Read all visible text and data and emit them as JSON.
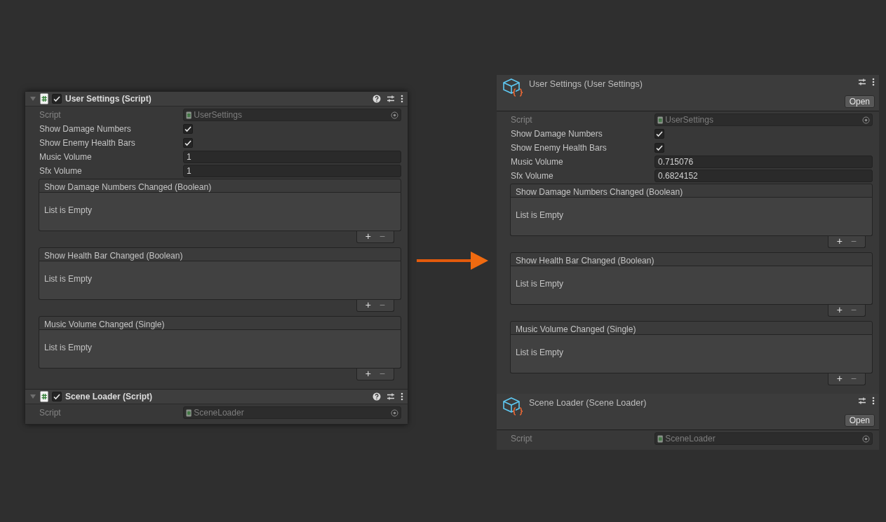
{
  "left_inspector": {
    "components": [
      {
        "kind": "script",
        "title": "User Settings (Script)",
        "expanded": true,
        "enabled": true,
        "fields": [
          {
            "kind": "object",
            "label": "Script",
            "value": "UserSettings",
            "disabled": true
          },
          {
            "kind": "toggle",
            "label": "Show Damage Numbers",
            "checked": true
          },
          {
            "kind": "toggle",
            "label": "Show Enemy Health Bars",
            "checked": true
          },
          {
            "kind": "number",
            "label": "Music Volume",
            "value": "1"
          },
          {
            "kind": "number",
            "label": "Sfx Volume",
            "value": "1"
          }
        ],
        "events": [
          {
            "title": "Show Damage Numbers Changed (Boolean)",
            "empty_text": "List is Empty",
            "add": "+",
            "remove": "−"
          },
          {
            "title": "Show Health Bar Changed (Boolean)",
            "empty_text": "List is Empty",
            "add": "+",
            "remove": "−"
          },
          {
            "title": "Music Volume Changed (Single)",
            "empty_text": "List is Empty",
            "add": "+",
            "remove": "−"
          }
        ]
      },
      {
        "kind": "script",
        "title": "Scene Loader (Script)",
        "expanded": true,
        "enabled": true,
        "fields": [
          {
            "kind": "object",
            "label": "Script",
            "value": "SceneLoader",
            "disabled": true
          }
        ]
      }
    ]
  },
  "right_inspector": {
    "components": [
      {
        "kind": "asset",
        "title": "User Settings (User Settings)",
        "button": "Open",
        "fields": [
          {
            "kind": "object",
            "label": "Script",
            "value": "UserSettings",
            "disabled": true
          },
          {
            "kind": "toggle",
            "label": "Show Damage Numbers",
            "checked": true
          },
          {
            "kind": "toggle",
            "label": "Show Enemy Health Bars",
            "checked": true
          },
          {
            "kind": "number",
            "label": "Music Volume",
            "value": "0.715076"
          },
          {
            "kind": "number",
            "label": "Sfx Volume",
            "value": "0.6824152"
          }
        ],
        "events": [
          {
            "title": "Show Damage Numbers Changed (Boolean)",
            "empty_text": "List is Empty",
            "add": "+",
            "remove": "−"
          },
          {
            "title": "Show Health Bar Changed (Boolean)",
            "empty_text": "List is Empty",
            "add": "+",
            "remove": "−"
          },
          {
            "title": "Music Volume Changed (Single)",
            "empty_text": "List is Empty",
            "add": "+",
            "remove": "−"
          }
        ]
      },
      {
        "kind": "asset",
        "title": "Scene Loader (Scene Loader)",
        "button": "Open",
        "fields": [
          {
            "kind": "object",
            "label": "Script",
            "value": "SceneLoader",
            "disabled": true
          }
        ]
      }
    ]
  }
}
